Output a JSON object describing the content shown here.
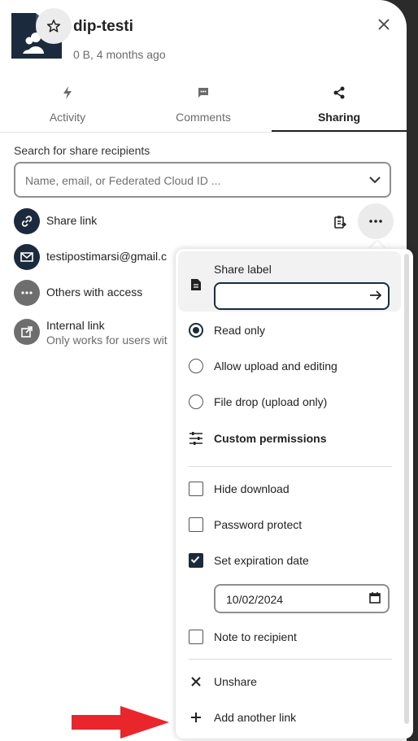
{
  "file": {
    "name": "dip-testi",
    "meta": "0 B, 4 months ago",
    "icon": "shared-folder-icon",
    "accent": "#1b2b3d"
  },
  "tabs": [
    {
      "label": "Activity",
      "icon": "bolt-icon"
    },
    {
      "label": "Comments",
      "icon": "comment-icon"
    },
    {
      "label": "Sharing",
      "icon": "share-icon",
      "active": true
    }
  ],
  "search": {
    "label": "Search for share recipients",
    "placeholder": "Name, email, or Federated Cloud ID ..."
  },
  "shares": {
    "share_link": "Share link",
    "email": "testipostimarsi@gmail.c",
    "others": "Others with access",
    "internal_title": "Internal link",
    "internal_sub": "Only works for users wit"
  },
  "menu": {
    "share_label_title": "Share label",
    "share_label_value": "",
    "read_only": "Read only",
    "allow_upload": "Allow upload and editing",
    "file_drop": "File drop (upload only)",
    "custom_permissions": "Custom permissions",
    "hide_download": "Hide download",
    "password_protect": "Password protect",
    "set_expiration": "Set expiration date",
    "expiration_date": "10/02/2024",
    "note_to_recipient": "Note to recipient",
    "unshare": "Unshare",
    "add_another_link": "Add another link",
    "selected_permission": "Read only",
    "expiration_checked": true
  },
  "colors": {
    "annotation_arrow": "#e8262b",
    "link_avatar": "#1b2b3d",
    "grey_avatar": "#6e6e6e"
  }
}
